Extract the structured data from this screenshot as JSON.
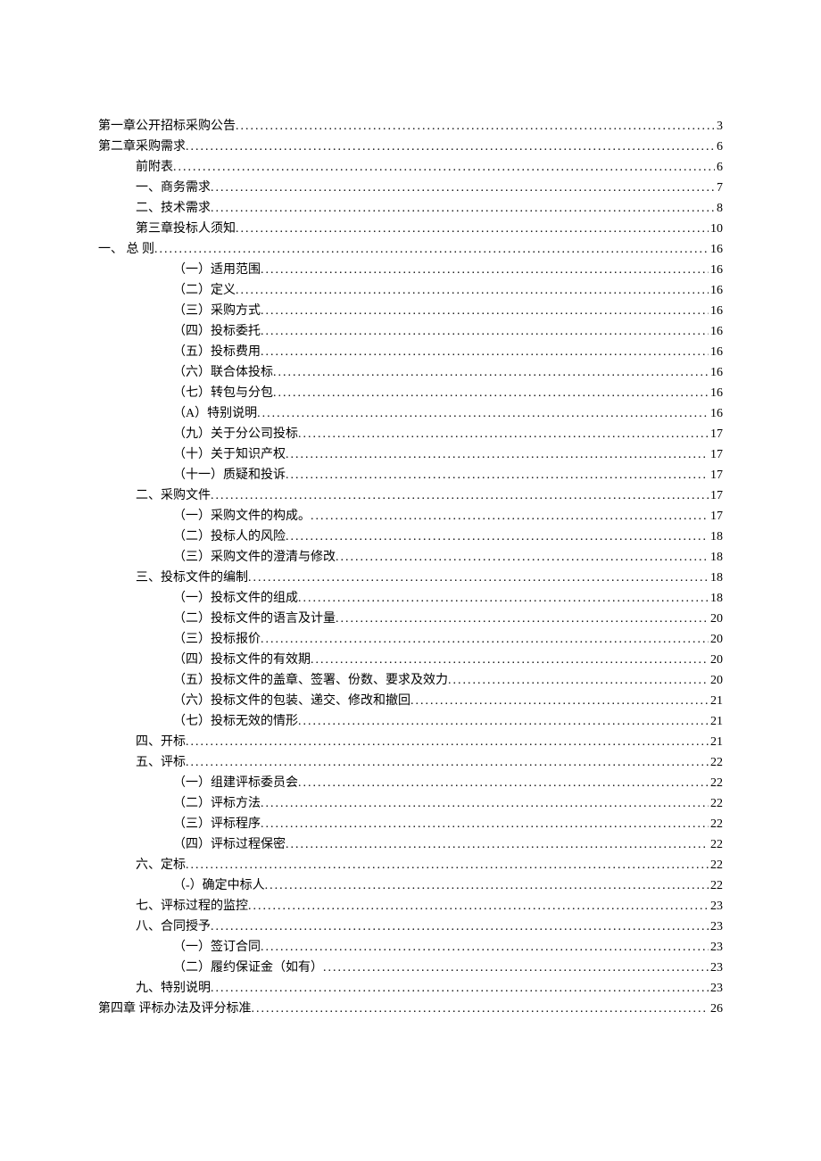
{
  "toc": [
    {
      "label": "第一章公开招标采购公告",
      "page": "3",
      "indent": 0
    },
    {
      "label": "第二章采购需求",
      "page": "6",
      "indent": 0
    },
    {
      "label": "前附表",
      "page": "6",
      "indent": 1
    },
    {
      "label": "一、商务需求",
      "page": "7",
      "indent": 1
    },
    {
      "label": "二、技术需求",
      "page": "8",
      "indent": 1
    },
    {
      "label": "第三章投标人须知",
      "page": "10",
      "indent": 1
    },
    {
      "label": "一、  总  则",
      "page": "16",
      "indent": 0
    },
    {
      "label": "（一）适用范围 ",
      "page": "16",
      "indent": 2
    },
    {
      "label": "（二）定义 ",
      "page": "16",
      "indent": 2
    },
    {
      "label": "（三）采购方式 ",
      "page": "16",
      "indent": 2
    },
    {
      "label": "（四）投标委托 ",
      "page": "16",
      "indent": 2
    },
    {
      "label": "（五）投标费用 ",
      "page": "16",
      "indent": 2
    },
    {
      "label": "（六）联合体投标 ",
      "page": "16",
      "indent": 2
    },
    {
      "label": "（七）转包与分包 ",
      "page": "16",
      "indent": 2
    },
    {
      "label": "（A）特别说明 ",
      "page": "16",
      "indent": 2
    },
    {
      "label": "（九）关于分公司投标 ",
      "page": "17",
      "indent": 2
    },
    {
      "label": "（十）关于知识产权 ",
      "page": "17",
      "indent": 2
    },
    {
      "label": "（十一）质疑和投诉 ",
      "page": "17",
      "indent": 2
    },
    {
      "label": "二、采购文件",
      "page": "17",
      "indent": 1
    },
    {
      "label": "（一）采购文件的构成。 ",
      "page": "17",
      "indent": 2
    },
    {
      "label": "（二）投标人的风险 ",
      "page": "18",
      "indent": 2
    },
    {
      "label": "（三）采购文件的澄清与修改 ",
      "page": "18",
      "indent": 2
    },
    {
      "label": "三、投标文件的编制",
      "page": "18",
      "indent": 1
    },
    {
      "label": "（一）投标文件的组成 ",
      "page": "18",
      "indent": 2
    },
    {
      "label": "（二）投标文件的语言及计量 ",
      "page": "20",
      "indent": 2
    },
    {
      "label": "（三）投标报价 ",
      "page": "20",
      "indent": 2
    },
    {
      "label": "（四）投标文件的有效期 ",
      "page": "20",
      "indent": 2
    },
    {
      "label": "（五）投标文件的盖章、签署、份数、要求及效力 ",
      "page": "20",
      "indent": 2
    },
    {
      "label": "（六）投标文件的包装、递交、修改和撤回 ",
      "page": "21",
      "indent": 2
    },
    {
      "label": "（七）投标无效的情形 ",
      "page": "21",
      "indent": 2
    },
    {
      "label": "四、开标",
      "page": "21",
      "indent": 1
    },
    {
      "label": "五、评标",
      "page": "22",
      "indent": 1
    },
    {
      "label": "（一）组建评标委员会 ",
      "page": "22",
      "indent": 2
    },
    {
      "label": "（二）评标方法 ",
      "page": "22",
      "indent": 2
    },
    {
      "label": "（三）评标程序 ",
      "page": "22",
      "indent": 2
    },
    {
      "label": "（四）评标过程保密 ",
      "page": "22",
      "indent": 2
    },
    {
      "label": "六、定标",
      "page": "22",
      "indent": 1
    },
    {
      "label": "（-）确定中标人 ",
      "page": "22",
      "indent": 2
    },
    {
      "label": "七、评标过程的监控",
      "page": "23",
      "indent": 1
    },
    {
      "label": "八、合同授予",
      "page": "23",
      "indent": 1
    },
    {
      "label": "（一）签订合同 ",
      "page": "23",
      "indent": 2
    },
    {
      "label": "（二）履约保证金（如有） ",
      "page": "23",
      "indent": 2
    },
    {
      "label": "九、特别说明",
      "page": "23",
      "indent": 1
    },
    {
      "label": "第四章  评标办法及评分标准",
      "page": "26",
      "indent": 0
    }
  ]
}
